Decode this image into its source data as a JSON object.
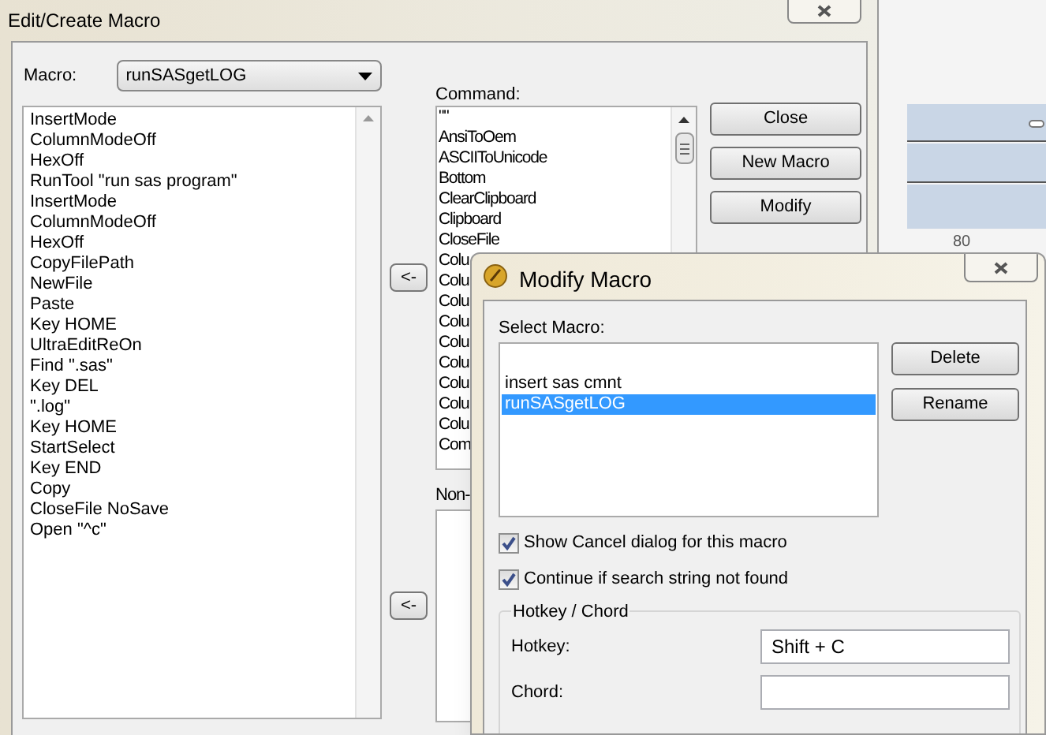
{
  "background": {
    "ruler_label": "80"
  },
  "main_dialog": {
    "title": "Edit/Create Macro",
    "macro_label": "Macro:",
    "macro_value": "runSASgetLOG",
    "macro_lines": [
      "InsertMode",
      "ColumnModeOff",
      "HexOff",
      "RunTool \"run sas program\"",
      "InsertMode",
      "ColumnModeOff",
      "HexOff",
      "CopyFilePath",
      "NewFile",
      "Paste",
      "Key HOME",
      "UltraEditReOn",
      "Find \".sas\"",
      "Key DEL",
      "\".log\"",
      "Key HOME",
      "StartSelect",
      "Key END",
      "Copy",
      "CloseFile NoSave",
      "Open \"^c\""
    ],
    "arrow_buttons": [
      "<-",
      "<-"
    ],
    "command_label": "Command:",
    "commands": [
      "\"\"",
      "AnsiToOem",
      "ASCIIToUnicode",
      "Bottom",
      "ClearClipboard",
      "Clipboard",
      "CloseFile",
      "Colu",
      "Colu",
      "Colu",
      "Colu",
      "Colu",
      "Colu",
      "Colu",
      "Colu",
      "Colu",
      "Com"
    ],
    "second_label": "Non-",
    "buttons": [
      "Close",
      "New Macro",
      "Modify"
    ]
  },
  "modify_dialog": {
    "title": "Modify Macro",
    "select_label": "Select Macro:",
    "macros": [
      {
        "label": "insert sas cmnt",
        "selected": false
      },
      {
        "label": "runSASgetLOG",
        "selected": true
      }
    ],
    "buttons": [
      "Delete",
      "Rename"
    ],
    "checkboxes": [
      {
        "label": "Show Cancel dialog for this macro",
        "checked": true
      },
      {
        "label": "Continue if search string not found",
        "checked": true
      }
    ],
    "group_title": "Hotkey / Chord",
    "fields": [
      {
        "label": "Hotkey:",
        "value": "Shift + C"
      },
      {
        "label": "Chord:"
      }
    ]
  }
}
